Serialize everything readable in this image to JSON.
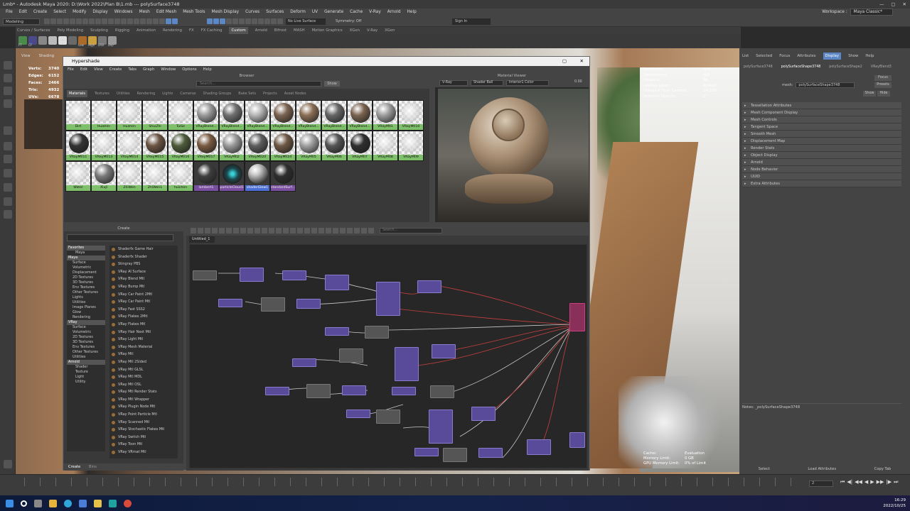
{
  "window": {
    "title": "Lmb* - Autodesk Maya 2020: D:\\Work 2022\\Plan B\\1.mb  ---  polySurface3748",
    "controls": [
      "—",
      "▢",
      "✕"
    ]
  },
  "menubar": {
    "items": [
      "File",
      "Edit",
      "Create",
      "Select",
      "Modify",
      "Display",
      "Windows",
      "Mesh",
      "Edit Mesh",
      "Mesh Tools",
      "Mesh Display",
      "Curves",
      "Surfaces",
      "Deform",
      "UV",
      "Generate",
      "Cache",
      "V-Ray",
      "Arnold",
      "Help"
    ],
    "workspace_label": "Workspace :",
    "workspace_value": "Maya Classic*"
  },
  "statusline": {
    "mode": "Modeling",
    "live_surface": "No Live Surface",
    "symmetry": "Symmetry: Off",
    "sign_in": "Sign In"
  },
  "shelf": {
    "tabs": [
      "Curves / Surfaces",
      "Poly Modeling",
      "Sculpting",
      "Rigging",
      "Animation",
      "Rendering",
      "FX",
      "FX Caching",
      "Custom",
      "Arnold",
      "Bifrost",
      "MASH",
      "Motion Graphics",
      "XGen",
      "V-Ray",
      "XGen"
    ],
    "active": "Custom",
    "icon_labels": [
      "FT",
      "CF",
      "Low",
      "High",
      "DSS",
      "Dsp"
    ]
  },
  "viewport": {
    "menu": [
      "View",
      "Shading"
    ],
    "stats_labels": [
      "Verts:",
      "Edges:",
      "Faces:",
      "Tris:",
      "UVs:"
    ],
    "stats_values": [
      "3740",
      "6152",
      "2466",
      "4932",
      "6678"
    ],
    "hud_top": [
      "Backfaces:",
      "Smoothness:",
      "Instance:",
      "Display Layer:",
      "Distance From Camera:",
      "Selected Objects:"
    ],
    "hud_top_values": [
      "N/A",
      "N/A",
      "No",
      "default",
      "14.210",
      "1"
    ],
    "hud_bottom": [
      "Cache:",
      "Memory Limit:",
      "GPU Memory Limit:"
    ],
    "hud_bottom_values": [
      "Evaluation",
      "0 GB",
      "0% of Limit"
    ]
  },
  "hypershade": {
    "title": "Hypershade",
    "close": "✕",
    "maximize": "▢",
    "menu": [
      "File",
      "Edit",
      "View",
      "Create",
      "Tabs",
      "Graph",
      "Window",
      "Options",
      "Help"
    ],
    "browser": {
      "title": "Browser",
      "search_placeholder": "Search...",
      "show": "Show",
      "tabs": [
        "Materials",
        "Textures",
        "Utilities",
        "Rendering",
        "Lights",
        "Cameras",
        "Shading Groups",
        "Bake Sets",
        "Projects",
        "Asset Nodes"
      ],
      "active_tab": "Materials",
      "materials": [
        {
          "name": "Dirt",
          "color": "#dcdcdc",
          "type": "tex"
        },
        {
          "name": "HuaHen",
          "color": "#cfcfcf",
          "type": "tex"
        },
        {
          "name": "Huahen",
          "color": "#d9d9d9",
          "type": "tex"
        },
        {
          "name": "ShuiZhi",
          "color": "#eeeeee",
          "type": "tex"
        },
        {
          "name": "TuiSe",
          "color": "#bfb3a0",
          "type": "tex"
        },
        {
          "name": "VRayBlend...",
          "color": "#9a9a9a",
          "type": "ball"
        },
        {
          "name": "VRayBlend...",
          "color": "#6f6f70",
          "type": "ball"
        },
        {
          "name": "VRayBlend...",
          "color": "#b5b5b5",
          "type": "ball"
        },
        {
          "name": "VRayBlend...",
          "color": "#7a6350",
          "type": "ball"
        },
        {
          "name": "VRayBlend...",
          "color": "#8a6e55",
          "type": "ball"
        },
        {
          "name": "VRayBlend...",
          "color": "#666",
          "type": "ball"
        },
        {
          "name": "VRayBlend...",
          "color": "#7a6350",
          "type": "ball"
        },
        {
          "name": "VRayMtl1",
          "color": "#9d9d9d",
          "type": "ball"
        },
        {
          "name": "VRayMtl10",
          "color": "#ededed",
          "type": "tex"
        },
        {
          "name": "VRayMtl11",
          "color": "#333",
          "type": "ball"
        },
        {
          "name": "VRayMtl13",
          "color": "#e5e5e5",
          "type": "tex"
        },
        {
          "name": "VRayMtl14",
          "color": "#d5d0c8",
          "type": "tex"
        },
        {
          "name": "VRayMtl15",
          "color": "#6b5443",
          "type": "ball"
        },
        {
          "name": "VRayMtl16",
          "color": "#4d5b3a",
          "type": "ball"
        },
        {
          "name": "VRayMtl17",
          "color": "#7a5a42",
          "type": "ball"
        },
        {
          "name": "VRayMtl2",
          "color": "#9a9a9a",
          "type": "ball"
        },
        {
          "name": "VRayMtl20",
          "color": "#5d5d5d",
          "type": "ball"
        },
        {
          "name": "VRayMtl24",
          "color": "#6d5845",
          "type": "ball"
        },
        {
          "name": "VRayMtl5",
          "color": "#a0a0a0",
          "type": "ball"
        },
        {
          "name": "VRayMtl6",
          "color": "#555",
          "type": "ball"
        },
        {
          "name": "VRayMtl7",
          "color": "#2f2f2f",
          "type": "ball"
        },
        {
          "name": "VRayMtl8",
          "color": "#ededed",
          "type": "tex"
        },
        {
          "name": "VRayMtl9",
          "color": "#e0e0e0",
          "type": "tex"
        },
        {
          "name": "Water",
          "color": "#e5e5e5",
          "type": "tex"
        },
        {
          "name": "XiuJi",
          "color": "#7a7a7a",
          "type": "ball"
        },
        {
          "name": "ZhiWen",
          "color": "#e2e2e2",
          "type": "tex"
        },
        {
          "name": "ZhiWen1",
          "color": "#d8d8d8",
          "type": "tex"
        },
        {
          "name": "huichen",
          "color": "#e8e8e8",
          "type": "tex"
        },
        {
          "name": "lambert1",
          "color": "#3e3e3e",
          "type": "dk"
        },
        {
          "name": "particleCloud1",
          "color": "#2a6f78",
          "type": "dk"
        },
        {
          "name": "shaderGlow1",
          "color": "#555",
          "type": "sel"
        },
        {
          "name": "standardSurf...",
          "color": "#2e2e2e",
          "type": "dk"
        }
      ]
    },
    "material_viewer": {
      "title": "Material Viewer",
      "renderer": "V-Ray",
      "geometry": "Shader Ball",
      "environment": "Interior1 Color",
      "exposure": "0.00"
    },
    "create": {
      "title": "Create",
      "tree": [
        {
          "label": "Favorites",
          "kind": "h"
        },
        {
          "label": "Maya",
          "kind": "s"
        },
        {
          "label": "Maya",
          "kind": "h"
        },
        {
          "label": "Surface",
          "kind": ""
        },
        {
          "label": "Volumetric",
          "kind": ""
        },
        {
          "label": "Displacement",
          "kind": ""
        },
        {
          "label": "2D Textures",
          "kind": ""
        },
        {
          "label": "3D Textures",
          "kind": ""
        },
        {
          "label": "Env Textures",
          "kind": ""
        },
        {
          "label": "Other Textures",
          "kind": ""
        },
        {
          "label": "Lights",
          "kind": ""
        },
        {
          "label": "Utilities",
          "kind": ""
        },
        {
          "label": "Image Planes",
          "kind": ""
        },
        {
          "label": "Glow",
          "kind": ""
        },
        {
          "label": "Rendering",
          "kind": ""
        },
        {
          "label": "VRay",
          "kind": "h"
        },
        {
          "label": "Surface",
          "kind": ""
        },
        {
          "label": "Volumetric",
          "kind": ""
        },
        {
          "label": "2D Textures",
          "kind": ""
        },
        {
          "label": "3D Textures",
          "kind": ""
        },
        {
          "label": "Env Textures",
          "kind": ""
        },
        {
          "label": "Other Textures",
          "kind": ""
        },
        {
          "label": "Utilities",
          "kind": ""
        },
        {
          "label": "Arnold",
          "kind": "h"
        },
        {
          "label": "Shader",
          "kind": "s"
        },
        {
          "label": "Texture",
          "kind": "s"
        },
        {
          "label": "Light",
          "kind": "s"
        },
        {
          "label": "Utility",
          "kind": "s"
        }
      ],
      "list": [
        "Shaderfx Game Hair",
        "Shaderfx Shader",
        "Stingray PBS",
        "VRay AI Surface",
        "VRay Blend Mtl",
        "VRay Bump Mtl",
        "VRay Car Paint 2Mtl",
        "VRay Car Paint Mtl",
        "VRay Fast SSS2",
        "VRay Flakes 2Mtl",
        "VRay Flakes Mtl",
        "VRay Hair Next Mtl",
        "VRay Light Mtl",
        "VRay Mesh Material",
        "VRay Mtl",
        "VRay Mtl 2Sided",
        "VRay Mtl GLSL",
        "VRay Mtl MDL",
        "VRay Mtl OSL",
        "VRay Mtl Render Stats",
        "VRay Mtl Wrapper",
        "VRay Plugin Node Mtl",
        "VRay Point Particle Mtl",
        "VRay Scanned Mtl",
        "VRay Stochastic Flakes Mtl",
        "VRay Switch Mtl",
        "VRay Toon Mtl",
        "VRay VRmat Mtl"
      ],
      "footer": [
        "Create",
        "Bins"
      ]
    },
    "graph": {
      "search_placeholder": "Search...",
      "tab": "Untitled_1"
    }
  },
  "attribute_editor": {
    "tabs": [
      "List",
      "Selected",
      "Focus",
      "Attributes",
      "Display",
      "Show",
      "Help"
    ],
    "active": "Display",
    "node_tabs": [
      "polySurface3748",
      "polySurfaceShape3748",
      "polySurfaceShape2",
      "VRayBlend3"
    ],
    "mesh_label": "mesh:",
    "mesh_value": "polySurfaceShape3748",
    "buttons": [
      "Focus",
      "Presets",
      "Show",
      "Hide"
    ],
    "sections": [
      "Tessellation Attributes",
      "Mesh Component Display",
      "Mesh Controls",
      "Tangent Space",
      "Smooth Mesh",
      "Displacement Map",
      "Render Stats",
      "Object Display",
      "Arnold",
      "Node Behavior",
      "UUID",
      "Extra Attributes"
    ],
    "notes": "Notes: _polySurfaceShape3748",
    "footer": [
      "Select",
      "Load Attributes",
      "Copy Tab"
    ]
  },
  "timeline": {
    "current_frame": "2",
    "controls": [
      "⏮",
      "◀|",
      "◀◀",
      "◀",
      "▶",
      "▶▶",
      "|▶",
      "⏭"
    ]
  },
  "taskbar": {
    "time": "16:29",
    "date": "2022/10/25"
  }
}
